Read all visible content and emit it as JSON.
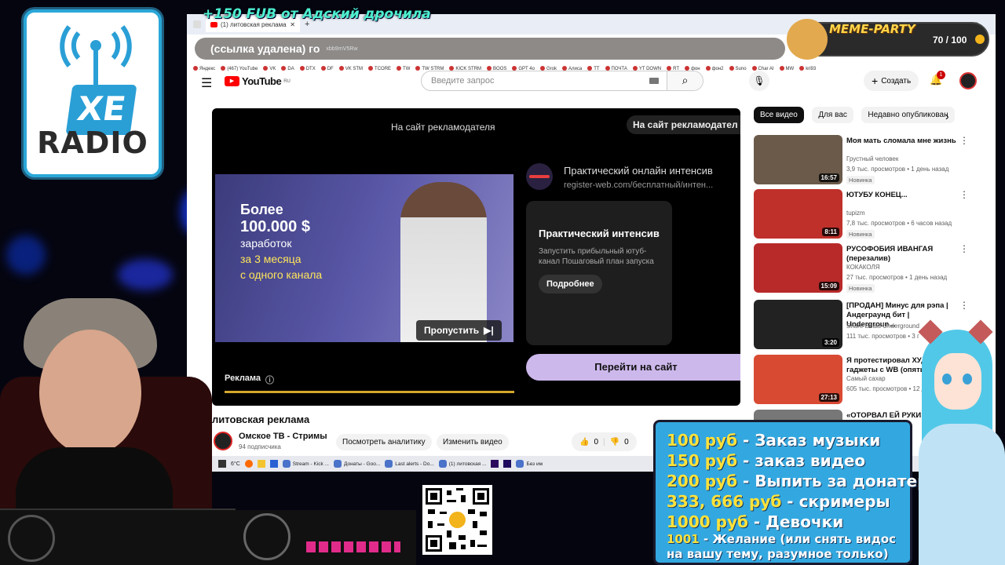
{
  "overlay": {
    "alert_text": "+150 FUB   от Адский дрочила",
    "logo_radio": "RADIO",
    "logo_xe": "XE",
    "meme_title": "MEME-PARTY",
    "meme_counter": "70 / 100",
    "donate_lines": [
      {
        "price": "100 руб",
        "text": " - Заказ музыки"
      },
      {
        "price": "150 руб",
        "text": " - заказ видео"
      },
      {
        "price": "200 руб",
        "text": " - Выпить за донатера"
      },
      {
        "price": "333, 666 руб",
        "text": " - скримеры"
      },
      {
        "price": "1000 руб",
        "text": " - Девочки"
      }
    ],
    "donate_wish_price": "1001",
    "donate_wish_text": " - Желание (или снять видос",
    "donate_wish_text2": "на вашу тему, разумное только)"
  },
  "browser": {
    "tab_title": "(1) литовская реклама - YouTube",
    "address": "(ссылка удалена) го",
    "address_suffix": "xbb9rnV5Rw",
    "bookmarks": [
      "Яндекс",
      "(467) YouTube",
      "VK",
      "DA",
      "DTX",
      "DF",
      "VK STM",
      "TCORE",
      "TW",
      "TW STRM",
      "KICK STRM",
      "BOOS",
      "GPT 4o",
      "Grok",
      "Алиса",
      "TT",
      "ПОЧТА",
      "YT DOWN",
      "RT",
      "фон",
      "фон2",
      "Suno",
      "Char AI",
      "MW",
      "kri93"
    ]
  },
  "youtube": {
    "logo": "YouTube",
    "region": "RU",
    "search_placeholder": "Введите запрос",
    "create_label": "Создать",
    "notif_count": "1",
    "ad": {
      "advertiser_link": "На сайт рекламодателя",
      "advertiser_link2": "На сайт рекламодател",
      "overlay_headline_1": "Более",
      "overlay_headline_2": "100.000 $",
      "overlay_line_3": "заработок",
      "overlay_line_4": "за 3 месяца",
      "overlay_line_5": "с одного канала",
      "card_title": "Практический онлайн интенсив",
      "card_url": "register-web.com/бесплатный/интен...",
      "panel_title": "Практический интенсив",
      "panel_desc": "Запустить прибыльный ютуб-канал Пошаговый план запуска",
      "panel_button": "Подробнее",
      "skip_label": "Пропустить",
      "ad_label": "Реклама",
      "cta_label": "Перейти на сайт"
    },
    "video_title": "литовская реклама",
    "channel_name": "Омское ТВ - Стримы",
    "subscribers": "94 подписчика",
    "analytics_btn": "Посмотреть аналитику",
    "edit_btn": "Изменить видео",
    "likes": "0",
    "dislikes": "0",
    "chips": [
      "Все видео",
      "Для вас",
      "Недавно опубликован"
    ],
    "recommendations": [
      {
        "title": "Моя мать сломала мне жизнь",
        "channel": "Грустный человек",
        "meta": "3,9 тыс. просмотров • 1 день назад",
        "badge": "Новинка",
        "duration": "16:57",
        "color": "#6b5a4a"
      },
      {
        "title": "ЮТУБУ КОНЕЦ...",
        "channel": "tupizm",
        "meta": "7,8 тыс. просмотров • 6 часов назад",
        "badge": "Новинка",
        "duration": "8:11",
        "color": "#c0302b"
      },
      {
        "title": "РУСОФОБИЯ ИВАНГАЯ (перезалив)",
        "channel": "КОКАКОЛЯ",
        "meta": "27 тыс. просмотров • 1 день назад",
        "badge": "Новинка",
        "duration": "15:09",
        "color": "#b82a2a"
      },
      {
        "title": "[ПРОДАН] Минус для рэпа | Андеграунд бит | Undergroun...",
        "channel": "Snare Beats Underground",
        "meta": "111 тыс. просмотров • 3 г",
        "badge": "",
        "duration": "3:20",
        "color": "#222"
      },
      {
        "title": "Я протестировал ХУДШ гаджеты с WB (опять)",
        "channel": "Самый сахар",
        "meta": "605 тыс. просмотров • 12 д",
        "badge": "",
        "duration": "27:13",
        "color": "#d94a33"
      },
      {
        "title": "«ОТОРВАЛ ЕЙ РУКИ И",
        "channel": "",
        "meta": "",
        "badge": "",
        "duration": "",
        "color": "#777"
      }
    ]
  },
  "taskbar": {
    "weather": "6°C",
    "items": [
      "Stream - Kick ...",
      "Донаты - Goo...",
      "Last alerts - Do...",
      "(1) литовская ...",
      "Без им"
    ]
  }
}
